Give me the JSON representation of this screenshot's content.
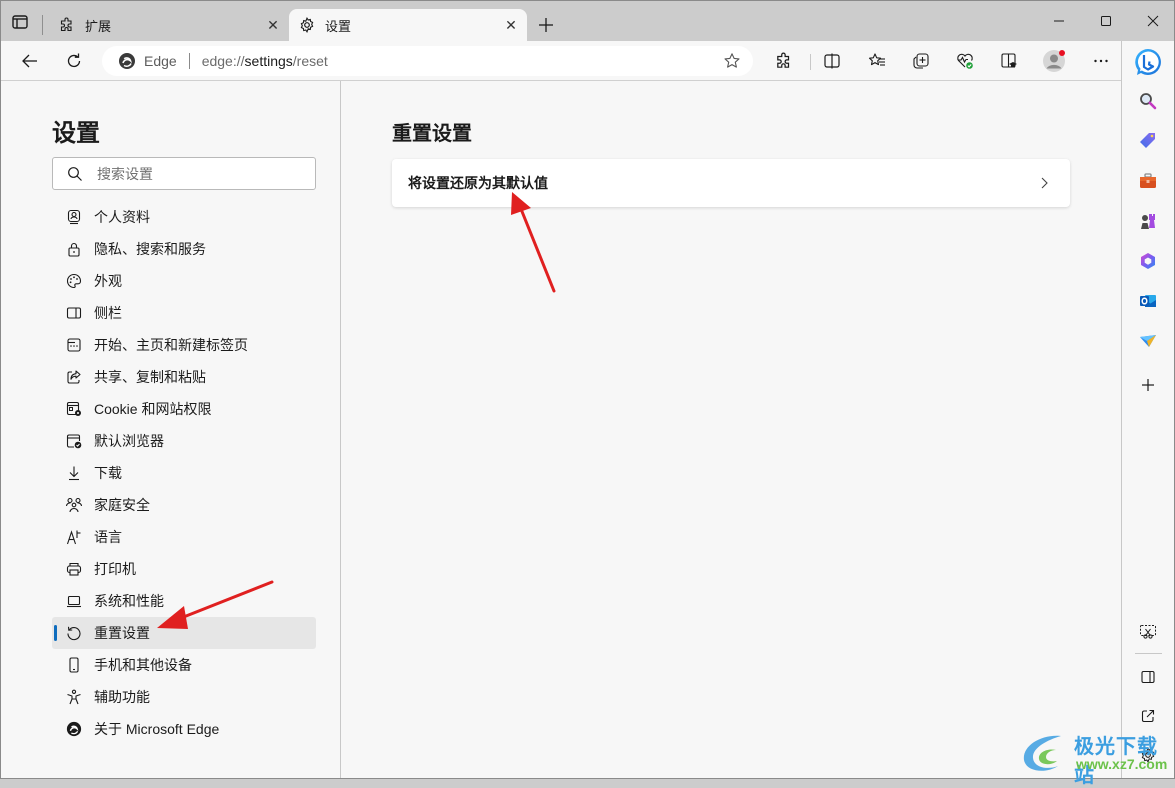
{
  "window": {
    "tabs": [
      {
        "label": "扩展",
        "icon": "puzzle-icon",
        "active": false
      },
      {
        "label": "设置",
        "icon": "gear-icon",
        "active": true
      }
    ],
    "new_tab_label": "+",
    "controls": {
      "minimize": "minimize-icon",
      "maximize": "maximize-icon",
      "close": "close-icon"
    }
  },
  "toolbar": {
    "back": "back-icon",
    "refresh": "refresh-icon",
    "site_label": "Edge",
    "url_prefix": "edge://",
    "url_host": "settings",
    "url_path": "/reset",
    "favorite": "star-icon",
    "buttons": [
      "extensions-icon",
      "split-screen-icon",
      "favorites-icon",
      "collections-icon",
      "browser-essentials-icon",
      "immersive-reader-icon",
      "profile-avatar",
      "more-icon"
    ]
  },
  "leftnav": {
    "title": "设置",
    "search_placeholder": "搜索设置",
    "items": [
      {
        "label": "个人资料",
        "icon": "profile-icon",
        "active": false
      },
      {
        "label": "隐私、搜索和服务",
        "icon": "lock-icon",
        "active": false
      },
      {
        "label": "外观",
        "icon": "palette-icon",
        "active": false
      },
      {
        "label": "侧栏",
        "icon": "sidebar-icon",
        "active": false
      },
      {
        "label": "开始、主页和新建标签页",
        "icon": "home-tab-icon",
        "active": false
      },
      {
        "label": "共享、复制和粘贴",
        "icon": "share-icon",
        "active": false
      },
      {
        "label": "Cookie 和网站权限",
        "icon": "cookie-permissions-icon",
        "active": false
      },
      {
        "label": "默认浏览器",
        "icon": "default-browser-icon",
        "active": false
      },
      {
        "label": "下载",
        "icon": "download-icon",
        "active": false
      },
      {
        "label": "家庭安全",
        "icon": "family-icon",
        "active": false
      },
      {
        "label": "语言",
        "icon": "language-icon",
        "active": false
      },
      {
        "label": "打印机",
        "icon": "printer-icon",
        "active": false
      },
      {
        "label": "系统和性能",
        "icon": "laptop-icon",
        "active": false
      },
      {
        "label": "重置设置",
        "icon": "reset-icon",
        "active": true
      },
      {
        "label": "手机和其他设备",
        "icon": "phone-icon",
        "active": false
      },
      {
        "label": "辅助功能",
        "icon": "accessibility-icon",
        "active": false
      },
      {
        "label": "关于 Microsoft Edge",
        "icon": "edge-logo-icon",
        "active": false
      }
    ]
  },
  "main": {
    "title": "重置设置",
    "card_label": "将设置还原为其默认值"
  },
  "sidebar_right": {
    "items": [
      "bing-chat-icon",
      "search-icon",
      "shopping-tag-icon",
      "tools-icon",
      "games-icon",
      "office-icon",
      "outlook-icon",
      "drop-icon",
      "add-icon"
    ],
    "bottom": [
      "screenshot-icon",
      "hide-sidebar-icon",
      "open-external-icon",
      "settings-icon"
    ]
  },
  "colors": {
    "accent": "#0f6cbd",
    "arrow": "#e02020",
    "notification_dot": "#e81123"
  },
  "watermark": {
    "text": "极光下载站",
    "url": "www.xz7.com"
  }
}
